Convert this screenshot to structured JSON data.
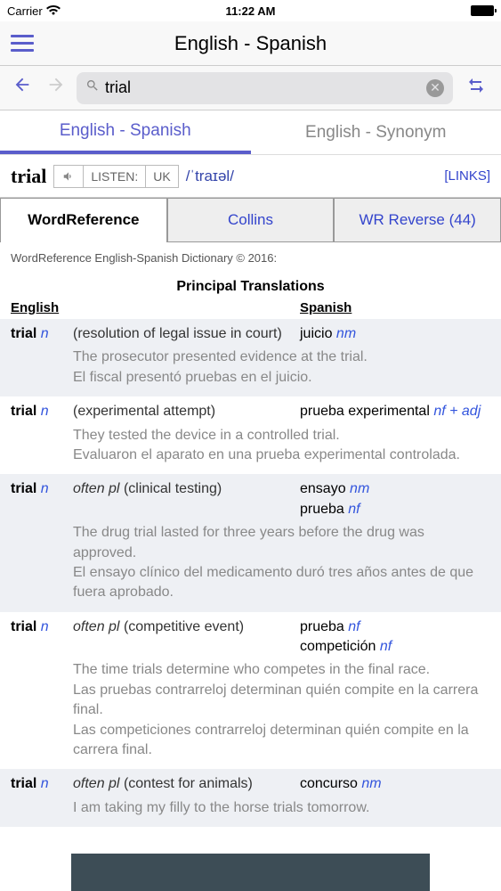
{
  "status": {
    "carrier": "Carrier",
    "time": "11:22 AM"
  },
  "header": {
    "title": "English - Spanish"
  },
  "search": {
    "value": "trial"
  },
  "langTabs": {
    "active": "English - Spanish",
    "inactive": "English - Synonym"
  },
  "wordHeader": {
    "headword": "trial",
    "listen": "LISTEN:",
    "region": "UK",
    "ipa": "/ˈtraɪəl/",
    "links": "[LINKS]"
  },
  "dictTabs": {
    "t1": "WordReference",
    "t2": "Collins",
    "t3": "WR Reverse (44)"
  },
  "copyright": "WordReference English-Spanish Dictionary © 2016:",
  "sectionTitle": "Principal Translations",
  "cols": {
    "en": "English",
    "es": "Spanish"
  },
  "entries": [
    {
      "word": "trial",
      "pos": "n",
      "gloss": "(resolution of legal issue in court)",
      "trans": [
        {
          "t": "juicio",
          "p": "nm"
        }
      ],
      "exEn": "The prosecutor presented evidence at the trial.",
      "exEs": [
        "El fiscal presentó pruebas en el juicio."
      ]
    },
    {
      "word": "trial",
      "pos": "n",
      "gloss": "(experimental attempt)",
      "trans": [
        {
          "t": "prueba experimental",
          "p": "nf + adj"
        }
      ],
      "exEn": "They tested the device in a controlled trial.",
      "exEs": [
        "Evaluaron el aparato en una prueba experimental controlada."
      ]
    },
    {
      "word": "trial",
      "pos": "n",
      "prefix": "often pl",
      "gloss": "(clinical testing)",
      "trans": [
        {
          "t": "ensayo",
          "p": "nm"
        },
        {
          "t": "prueba",
          "p": "nf"
        }
      ],
      "exEn": "The drug trial lasted for three years before the drug was approved.",
      "exEs": [
        "El ensayo clínico del medicamento duró tres años antes de que fuera aprobado."
      ]
    },
    {
      "word": "trial",
      "pos": "n",
      "prefix": "often pl",
      "gloss": "(competitive event)",
      "trans": [
        {
          "t": "prueba",
          "p": "nf"
        },
        {
          "t": "competición",
          "p": "nf"
        }
      ],
      "exEn": "The time trials determine who competes in the final race.",
      "exEs": [
        "Las pruebas contrarreloj determinan quién compite en la carrera final.",
        "Las competiciones contrarreloj determinan quién compite en la carrera final."
      ]
    },
    {
      "word": "trial",
      "pos": "n",
      "prefix": "often pl",
      "gloss": "(contest for animals)",
      "trans": [
        {
          "t": "concurso",
          "p": "nm"
        }
      ],
      "exEn": "I am taking my filly to the horse trials tomorrow.",
      "exEs": []
    }
  ]
}
